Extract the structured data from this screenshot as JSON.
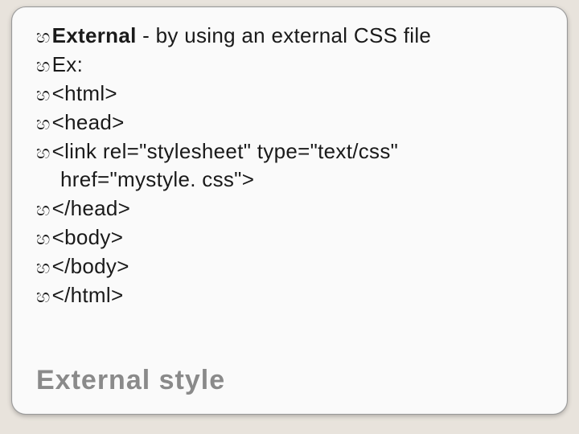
{
  "bullet_glyph": "හ",
  "lines": [
    {
      "bold": "External",
      "rest": " - by using an external CSS file"
    },
    {
      "bold": "",
      "rest": "Ex:"
    },
    {
      "bold": "",
      "rest": "<html>"
    },
    {
      "bold": "",
      "rest": "<head>"
    },
    {
      "bold": "",
      "rest": "<link rel=\"stylesheet\" type=\"text/css\""
    },
    {
      "cont": true,
      "rest": "href=\"mystyle. css\">"
    },
    {
      "bold": "",
      "rest": "</head>"
    },
    {
      "bold": "",
      "rest": "<body>"
    },
    {
      "bold": "",
      "rest": "</body>"
    },
    {
      "bold": "",
      "rest": "</html>"
    }
  ],
  "title": "External style"
}
